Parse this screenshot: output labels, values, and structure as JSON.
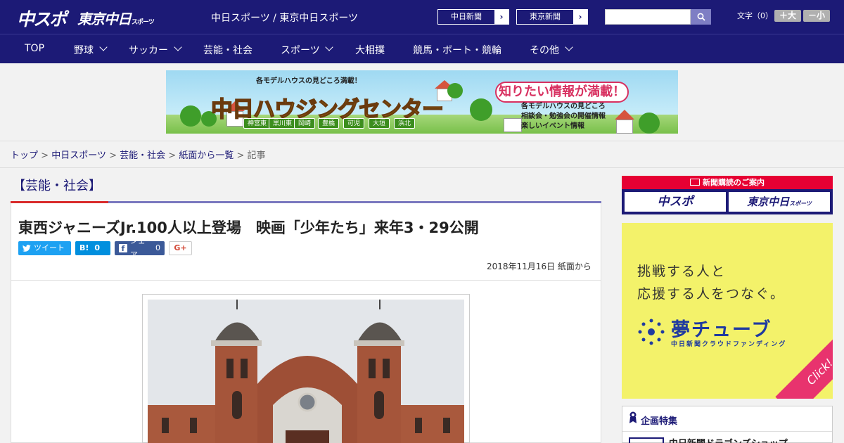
{
  "header": {
    "logo_chuspo": "中スポ",
    "logo_tokyo": "東京中日",
    "logo_tokyo_small": "スポーツ",
    "site_title": "中日スポーツ / 東京中日スポーツ",
    "ext_links": [
      {
        "label": "中日新聞",
        "arrow": "›"
      },
      {
        "label": "東京新聞",
        "arrow": "›"
      }
    ],
    "search": {
      "placeholder": "",
      "button_icon": "search-icon"
    },
    "font_size_label": "文字（0）",
    "font_larger": "＋大",
    "font_smaller": "－小"
  },
  "nav": {
    "items": [
      {
        "label": "TOP",
        "dropdown": false
      },
      {
        "label": "野球",
        "dropdown": true
      },
      {
        "label": "サッカー",
        "dropdown": true
      },
      {
        "label": "芸能・社会",
        "dropdown": false
      },
      {
        "label": "スポーツ",
        "dropdown": true
      },
      {
        "label": "大相撲",
        "dropdown": false
      },
      {
        "label": "競馬・ボート・競輪",
        "dropdown": false
      },
      {
        "label": "その他",
        "dropdown": true
      }
    ]
  },
  "banner": {
    "tagline": "各モデルハウスの見どころ満載！",
    "headline": "中日ハウジングセンター",
    "speech": "知りたい情報が満載！",
    "features": [
      "各モデルハウスの見どころ",
      "相談会・勉強会の開催情報",
      "楽しいイベント情報"
    ],
    "cities": [
      "神宮東",
      "黒川東",
      "岡崎",
      "豊橋",
      "可児",
      "大垣",
      "浜北"
    ]
  },
  "breadcrumb": {
    "items": [
      "トップ",
      "中日スポーツ",
      "芸能・社会",
      "紙面から一覧"
    ],
    "current": "記事",
    "separator": ">"
  },
  "section": {
    "title": "【芸能・社会】"
  },
  "article": {
    "title": "東西ジャニーズJr.100人以上登場　映画「少年たち」来年3・29公開",
    "share": {
      "tweet": "ツイート",
      "hatena_label": "B!",
      "hatena_count": "0",
      "facebook_label": "シェア",
      "facebook_count": "0",
      "gplus": "G+"
    },
    "date": "2018年11月16日 紙面から"
  },
  "sidebar": {
    "subscribe_header": "新聞購読のご案内",
    "subscribe_buttons": [
      "中スポ",
      "東京中日"
    ],
    "subscribe_small": "スポーツ",
    "yume": {
      "line1": "挑戦する人と",
      "line2": "応援する人をつなぐ。",
      "brand": "夢チューブ",
      "sub": "中日新聞クラウドファンディング",
      "click": "Click!"
    },
    "plan": {
      "heading": "企画特集",
      "item": "中日新聞ドラゴンズショップ"
    }
  },
  "colors": {
    "brand_navy": "#1c1a76",
    "accent_red": "#d92b2b",
    "twitter": "#1da1f2",
    "hatena": "#008fde",
    "facebook": "#3b5998"
  }
}
